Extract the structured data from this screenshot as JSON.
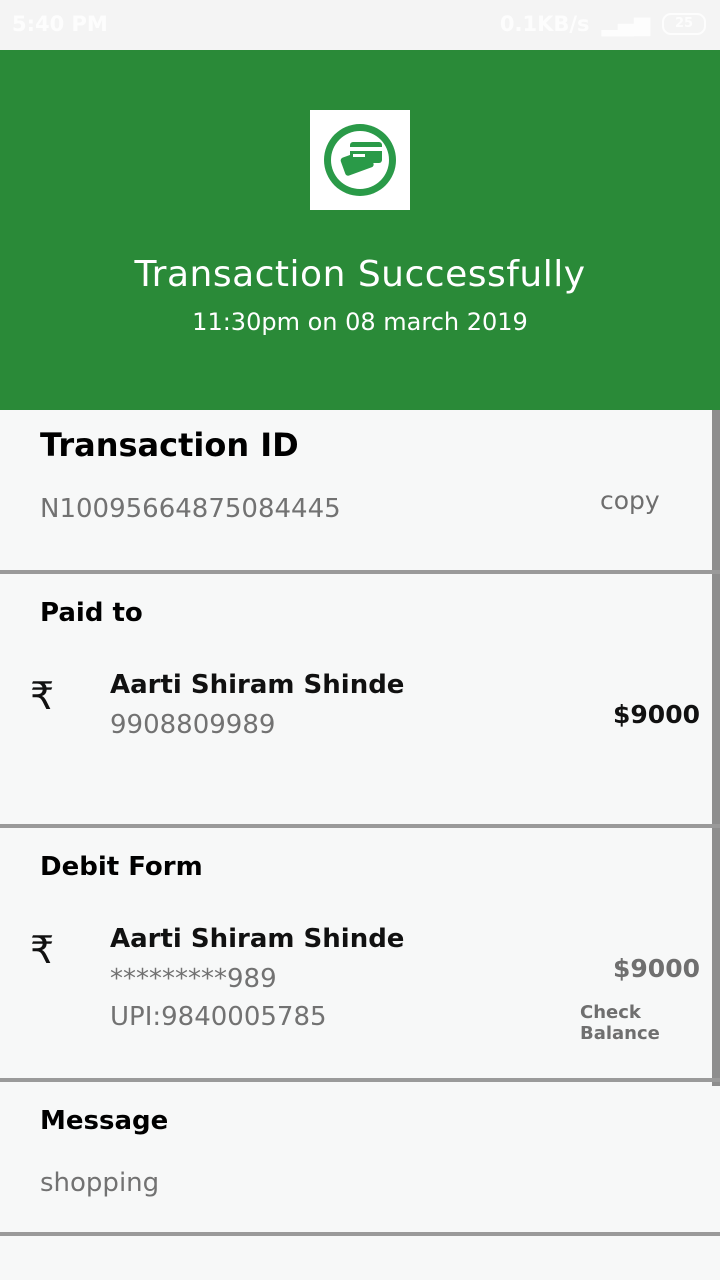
{
  "status_bar": {
    "time": "5:40 PM",
    "network_speed": "0.1KB/s",
    "battery": "25"
  },
  "header": {
    "title": "Transaction Successfully",
    "subtitle": "11:30pm on 08 march 2019",
    "icon": "card-payment-icon"
  },
  "transaction": {
    "heading": "Transaction ID",
    "id": "N10095664875084445",
    "copy_label": "copy"
  },
  "paid_to": {
    "heading": "Paid to",
    "currency_symbol": "₹",
    "name": "Aarti Shiram Shinde",
    "phone": "9908809989",
    "amount": "$9000"
  },
  "debit_from": {
    "heading": "Debit Form",
    "currency_symbol": "₹",
    "name": "Aarti Shiram Shinde",
    "masked_account": "*********989",
    "upi": "UPI:9840005785",
    "amount": "$9000",
    "check_balance_label": "Check Balance"
  },
  "message": {
    "heading": "Message",
    "text": "shopping"
  },
  "colors": {
    "header_green": "#2a8a38",
    "background": "#f7f8f8",
    "divider": "#9a9a9a"
  }
}
